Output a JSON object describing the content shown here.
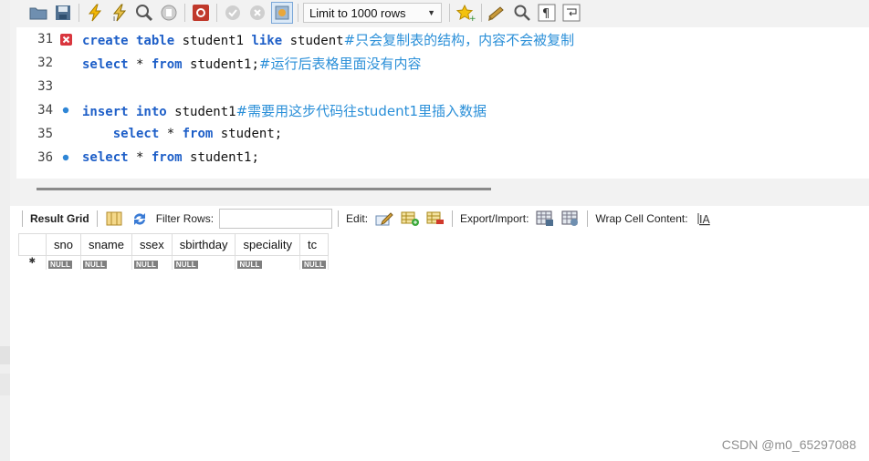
{
  "toolbar": {
    "limit_label": "Limit to 1000 rows",
    "icons": [
      "folder-icon",
      "save-icon",
      "execute-icon",
      "execute-current-icon",
      "explain-icon",
      "stop-icon",
      "toggle-error-icon",
      "commit-icon",
      "rollback-icon",
      "autocommit-icon",
      "favorite-icon",
      "beautify-icon",
      "find-icon",
      "invisible-chars-icon",
      "wrap-icon"
    ]
  },
  "code_lines": [
    {
      "num": "31",
      "marker": "error",
      "parts": [
        {
          "t": "kw",
          "v": "create table "
        },
        {
          "t": "tx",
          "v": "student1 "
        },
        {
          "t": "kw",
          "v": "like "
        },
        {
          "t": "tx",
          "v": "student"
        },
        {
          "t": "cm",
          "v": "#只会复制表的结构，内容不会被复制"
        }
      ]
    },
    {
      "num": "32",
      "marker": "",
      "parts": [
        {
          "t": "kw",
          "v": "select "
        },
        {
          "t": "tx",
          "v": "* "
        },
        {
          "t": "kw",
          "v": "from "
        },
        {
          "t": "tx",
          "v": "student1;"
        },
        {
          "t": "cm",
          "v": "#运行后表格里面没有内容"
        }
      ]
    },
    {
      "num": "33",
      "marker": "",
      "parts": []
    },
    {
      "num": "34",
      "marker": "dot",
      "parts": [
        {
          "t": "kw",
          "v": "insert into "
        },
        {
          "t": "tx",
          "v": "student1"
        },
        {
          "t": "cm",
          "v": "#需要用这步代码往student1里插入数据"
        }
      ]
    },
    {
      "num": "35",
      "marker": "",
      "parts": [
        {
          "t": "tx",
          "v": "    "
        },
        {
          "t": "kw",
          "v": "select "
        },
        {
          "t": "tx",
          "v": "* "
        },
        {
          "t": "kw",
          "v": "from "
        },
        {
          "t": "tx",
          "v": "student;"
        }
      ]
    },
    {
      "num": "36",
      "marker": "dot",
      "parts": [
        {
          "t": "kw",
          "v": "select "
        },
        {
          "t": "tx",
          "v": "* "
        },
        {
          "t": "kw",
          "v": "from "
        },
        {
          "t": "tx",
          "v": "student1;"
        }
      ]
    }
  ],
  "result_bar": {
    "result_grid": "Result Grid",
    "filter_rows": "Filter Rows:",
    "filter_value": "",
    "edit": "Edit:",
    "export_import": "Export/Import:",
    "wrap_cell": "Wrap Cell Content:"
  },
  "grid": {
    "columns": [
      "sno",
      "sname",
      "ssex",
      "sbirthday",
      "speciality",
      "tc"
    ],
    "row_marker": "✱",
    "null_label": "NULL"
  },
  "watermark": "CSDN @m0_65297088"
}
